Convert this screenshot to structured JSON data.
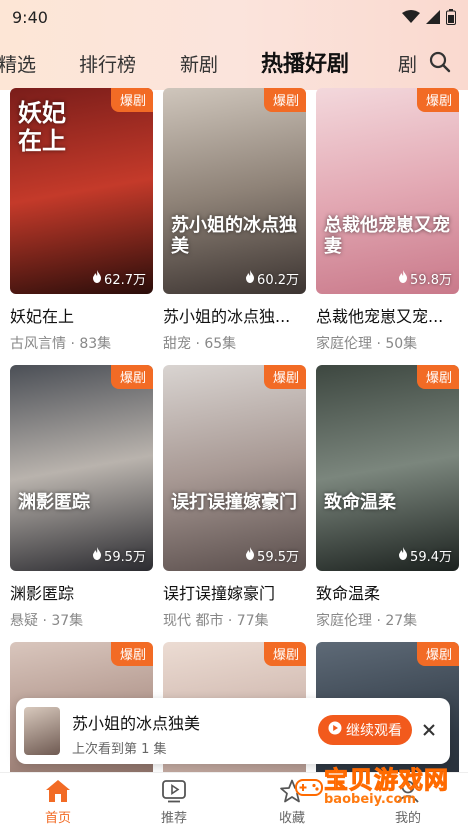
{
  "status_bar": {
    "time": "9:40"
  },
  "tabs": [
    {
      "label": "精选"
    },
    {
      "label": "排行榜"
    },
    {
      "label": "新剧"
    },
    {
      "label": "热播好剧"
    },
    {
      "label": "剧"
    }
  ],
  "cards": [
    {
      "title": "妖妃在上",
      "meta": "古风言情 · 83集",
      "badge": "爆剧",
      "views": "62.7万",
      "art_text": "妖妃在上",
      "colors": [
        "#7a1d1a",
        "#c43a2a",
        "#2a0d0a"
      ]
    },
    {
      "title": "苏小姐的冰点独...",
      "meta": "甜宠 · 65集",
      "badge": "爆剧",
      "views": "60.2万",
      "art_text": "苏小姐的冰点独美",
      "colors": [
        "#cfc6bc",
        "#8f8378",
        "#3c3431"
      ]
    },
    {
      "title": "总裁他宠崽又宠...",
      "meta": "家庭伦理 · 50集",
      "badge": "爆剧",
      "views": "59.8万",
      "art_text": "总裁他宠崽又宠妻",
      "colors": [
        "#f3d8dc",
        "#e3a9b4",
        "#c9798a"
      ]
    },
    {
      "title": "渊影匿踪",
      "meta": "悬疑 · 37集",
      "badge": "爆剧",
      "views": "59.5万",
      "art_text": "渊影匿踪",
      "colors": [
        "#4b4f56",
        "#b9b3ad",
        "#2b2b30"
      ]
    },
    {
      "title": "误打误撞嫁豪门",
      "meta": "现代 都市 · 77集",
      "badge": "爆剧",
      "views": "59.5万",
      "art_text": "误打误撞嫁豪门",
      "colors": [
        "#d9d4d1",
        "#a89994",
        "#5a4e4c"
      ]
    },
    {
      "title": "致命温柔",
      "meta": "家庭伦理 · 27集",
      "badge": "爆剧",
      "views": "59.4万",
      "art_text": "致命温柔",
      "colors": [
        "#3d4740",
        "#7b867d",
        "#1c221f"
      ]
    },
    {
      "title": "",
      "meta": "",
      "badge": "爆剧",
      "views": "",
      "art_text": "",
      "colors": [
        "#d9c6bd",
        "#a78a80",
        "#5d463f"
      ]
    },
    {
      "title": "",
      "meta": "",
      "badge": "爆剧",
      "views": "",
      "art_text": "",
      "colors": [
        "#ecdcd3",
        "#c9b0a7",
        "#8b6f66"
      ]
    },
    {
      "title": "",
      "meta": "",
      "badge": "爆剧",
      "views": "",
      "art_text": "",
      "colors": [
        "#5e6a77",
        "#303a45",
        "#1d2229"
      ]
    }
  ],
  "resume": {
    "title": "苏小姐的冰点独美",
    "subtitle": "上次看到第 1 集",
    "button": "继续观看"
  },
  "bottom_nav": [
    {
      "label": "首页",
      "icon": "home-icon",
      "active": true
    },
    {
      "label": "推荐",
      "icon": "play-icon",
      "active": false
    },
    {
      "label": "收藏",
      "icon": "star-icon",
      "active": false
    },
    {
      "label": "我的",
      "icon": "user-icon",
      "active": false
    }
  ],
  "watermark": {
    "text": "宝贝游戏网",
    "url": "baobeiy.com"
  },
  "colors": {
    "accent": "#f26b25",
    "badge": "#f26b25",
    "button": "#f25a1c"
  }
}
